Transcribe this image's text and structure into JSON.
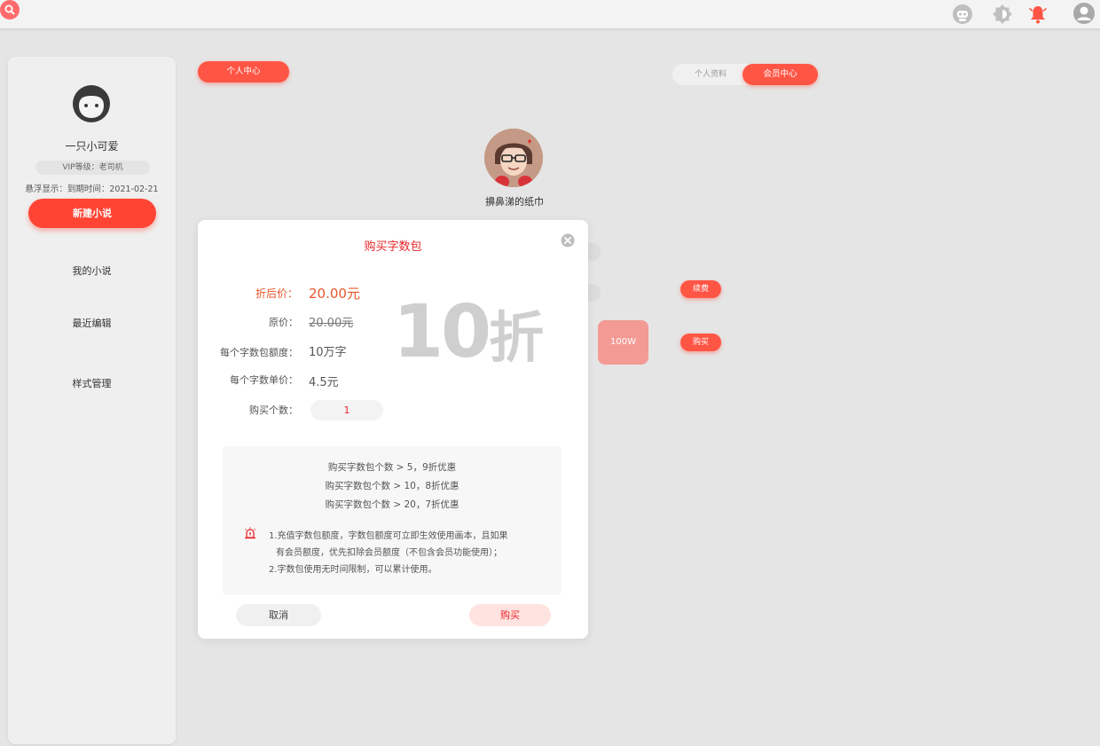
{
  "colors": {
    "accent": "#ff5545",
    "title_red": "#e8262a",
    "price_orange": "#e8562a",
    "watermark_gray": "#cfcfcf"
  },
  "topbar": {
    "icons": [
      "search-icon",
      "robot-icon",
      "theme-icon",
      "bell-icon",
      "user-icon"
    ]
  },
  "sidebar": {
    "username": "一只小可爱",
    "vip_level": "VIP等级：老司机",
    "expire_text": "悬浮显示：到期时间：2021-02-21",
    "new_novel_label": "新建小说",
    "links": [
      "我的小说",
      "最近编辑",
      "样式管理"
    ]
  },
  "main": {
    "personal_center_label": "个人中心",
    "tabs": [
      "个人资料",
      "会员中心"
    ],
    "active_tab": "会员中心",
    "profile_name": "擤鼻涕的纸巾",
    "renew_label": "续费",
    "buy_label": "购买",
    "package_tile_label": "100W"
  },
  "modal": {
    "title": "购买字数包",
    "discount_price_label": "折后价：",
    "discount_price_value": "20.00元",
    "original_price_label": "原价：",
    "original_price_value": "20.00元",
    "quota_label": "每个字数包额度：",
    "quota_value": "10万字",
    "unit_price_label": "每个字数单价：",
    "unit_price_value": "4.5元",
    "quantity_label": "购买个数：",
    "quantity_value": "1",
    "discount_number": "10",
    "discount_unit": "折",
    "rules": [
      "购买字数包个数 >  5，9折优惠",
      "购买字数包个数 > 10，8折优惠",
      "购买字数包个数 > 20，7折优惠"
    ],
    "notes": [
      "1.充值字数包额度，字数包额度可立即生效使用画本，且如果",
      "有会员额度，优先扣除会员额度（不包含会员功能使用）；",
      "2.字数包使用无时间限制，可以累计使用。"
    ],
    "cancel_label": "取消",
    "buy_label": "购买"
  }
}
